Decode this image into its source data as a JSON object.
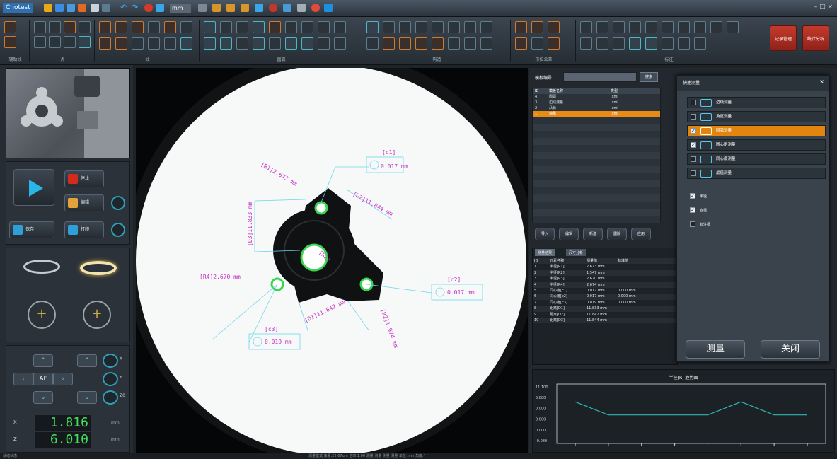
{
  "app": {
    "name": "Chotest",
    "unit": "mm",
    "window_controls": "– □ ×"
  },
  "ribbon": {
    "groups": [
      {
        "label": "辅助线"
      },
      {
        "label": "点"
      },
      {
        "label": "线"
      },
      {
        "label": "圆弧"
      },
      {
        "label": "构造"
      },
      {
        "label": "形位公差"
      },
      {
        "label": "标注"
      }
    ],
    "big_buttons": [
      {
        "label": "记录管理"
      },
      {
        "label": "统计分析"
      }
    ]
  },
  "left": {
    "stop_label": "停止",
    "btn_new": "编辑",
    "btn_save": "保存",
    "btn_print": "打印",
    "af_label": "AF",
    "z_labels": [
      "X",
      "Y",
      "Z0"
    ],
    "readouts": [
      {
        "axis": "X",
        "value": "1.816",
        "unit": "mm"
      },
      {
        "axis": "Z",
        "value": "6.010",
        "unit": "mm"
      }
    ]
  },
  "view": {
    "dims": [
      {
        "text": "[R1]2.673 mm"
      },
      {
        "text": "[D3]11.833 mm"
      },
      {
        "text": "[D2]11.844 mm"
      },
      {
        "text": "[R4]2.670 mm"
      },
      {
        "text": "[D1]11.842 mm"
      },
      {
        "text": "[R2]1.974 mm"
      },
      {
        "text": "[R2]"
      }
    ],
    "frames": [
      {
        "tag": "[c1]",
        "value": "0.017 mm"
      },
      {
        "tag": "[c2]",
        "value": "0.017 mm"
      },
      {
        "tag": "[c3]",
        "value": "0.019 mm"
      }
    ]
  },
  "parts": {
    "label": "模板编号",
    "search_btn": "搜索",
    "columns": [
      "ID",
      "模板名称",
      "类型"
    ],
    "rows": [
      [
        "4",
        "圆弧",
        ".xml"
      ],
      [
        "3",
        "边线测量",
        ".xml"
      ],
      [
        "2",
        "凸轮",
        ".xml"
      ],
      [
        "1",
        "轴承",
        ".xml"
      ]
    ],
    "buttons": [
      "导入",
      "编辑",
      "新建",
      "删除",
      "应用"
    ]
  },
  "measure_table": {
    "tabs": [
      "测量结果",
      "尺寸分析"
    ],
    "columns": [
      "ID",
      "元素名称",
      "测量值",
      "标准值",
      ""
    ],
    "rows": [
      [
        "1",
        "半径[R1]",
        "2.673 mm",
        "",
        ""
      ],
      [
        "2",
        "半径[R2]",
        "1.547 mm",
        "",
        ""
      ],
      [
        "3",
        "半径[R3]",
        "2.670 mm",
        "",
        ""
      ],
      [
        "4",
        "半径[R4]",
        "2.674 mm",
        "",
        ""
      ],
      [
        "5",
        "同心度[c1]",
        "0.017 mm",
        "0.000 mm",
        ""
      ],
      [
        "6",
        "同心度[c2]",
        "0.017 mm",
        "0.000 mm",
        ""
      ],
      [
        "7",
        "同心度[c3]",
        "0.019 mm",
        "0.000 mm",
        ""
      ],
      [
        "8",
        "距离[D1]",
        "11.833 mm",
        "",
        ""
      ],
      [
        "9",
        "距离[D2]",
        "11.842 mm",
        "",
        ""
      ],
      [
        "10",
        "距离[D3]",
        "11.844 mm",
        "",
        ""
      ]
    ]
  },
  "dialog": {
    "title": "快速测量",
    "close": "×",
    "items": [
      {
        "label": "边线测量",
        "checked": false
      },
      {
        "label": "角度测量",
        "checked": false
      },
      {
        "label": "圆弧测量",
        "checked": true
      },
      {
        "label": "圆心距测量",
        "checked": true
      },
      {
        "label": "同心度测量",
        "checked": false
      },
      {
        "label": "最值测量",
        "checked": false
      }
    ],
    "options": [
      {
        "label": "半径",
        "checked": true
      },
      {
        "label": "直径",
        "checked": true
      },
      {
        "label": "标注框",
        "checked": false
      }
    ],
    "btn_measure": "测量",
    "btn_close": "关闭"
  },
  "trend": {
    "title": "半径[R] 趋势图",
    "y_ticks": [
      "11.100",
      "5.880",
      "0.000",
      "0.000",
      "0.000",
      "-0.080"
    ]
  },
  "status": {
    "left": "就绪状态",
    "right": "测量模式  像素:22.67um  倍率:1.00  测量  测量  测量  测量  单位:mm  角度:°"
  },
  "chart_data": {
    "type": "line",
    "title": "半径[R] 趋势图",
    "x": [
      1,
      2,
      3,
      4,
      5,
      6,
      7,
      8
    ],
    "series": [
      {
        "values": [
          2.68,
          2.66,
          2.66,
          2.66,
          2.66,
          2.68,
          2.66,
          2.66
        ]
      }
    ],
    "ylim": [
      -0.08,
      11.1
    ],
    "grid": false
  }
}
